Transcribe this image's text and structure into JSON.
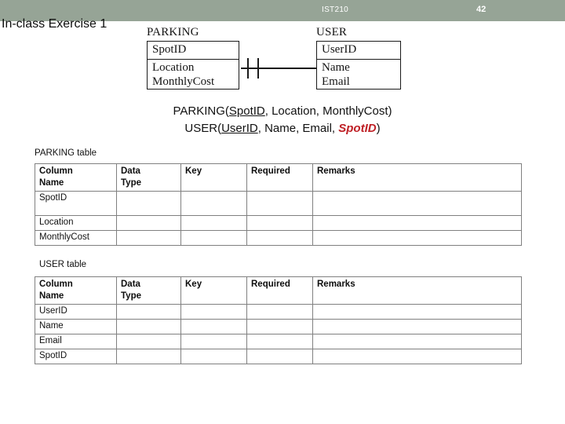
{
  "banner": {
    "course": "IST210",
    "page_number": "42",
    "background_color": "#96a496"
  },
  "slide": {
    "title": "In-class Exercise 1"
  },
  "er_diagram": {
    "entities": [
      {
        "name": "PARKING",
        "primary_key": "SpotID",
        "attributes": "Location\nMonthlyCost",
        "attribute_line_1": "Location",
        "attribute_line_2": "MonthlyCost"
      },
      {
        "name": "USER",
        "primary_key": "UserID",
        "attribute_line_1": "Name",
        "attribute_line_2": "Email"
      }
    ],
    "relationship": {
      "left_cardinality": "one-and-only-one",
      "right_cardinality": "zero-or-one"
    }
  },
  "schema": {
    "parking": {
      "entity": "PARKING(",
      "pk": "SpotID",
      "rest": ", Location, MonthlyCost)"
    },
    "user": {
      "entity": "USER(",
      "pk": "UserID",
      "mid": ", Name, Email, ",
      "fk": "SpotID",
      "close": ")"
    },
    "fk_color": "#bf2026"
  },
  "tables": [
    {
      "label": "PARKING table",
      "headers": [
        "Column Name",
        "Data Type",
        "Key",
        "Required",
        "Remarks"
      ],
      "header_lines": [
        [
          "Column",
          "Name"
        ],
        [
          "Data",
          "Type"
        ],
        [
          "Key",
          ""
        ],
        [
          "Required",
          ""
        ],
        [
          "Remarks",
          ""
        ]
      ],
      "rows": [
        {
          "name": "SpotID",
          "data_type": "",
          "key": "",
          "required": "",
          "remarks": ""
        },
        {
          "name": "Location",
          "data_type": "",
          "key": "",
          "required": "",
          "remarks": ""
        },
        {
          "name": "MonthlyCost",
          "data_type": "",
          "key": "",
          "required": "",
          "remarks": ""
        }
      ]
    },
    {
      "label": "USER table",
      "headers": [
        "Column Name",
        "Data Type",
        "Key",
        "Required",
        "Remarks"
      ],
      "header_lines": [
        [
          "Column",
          "Name"
        ],
        [
          "Data",
          "Type"
        ],
        [
          "Key",
          ""
        ],
        [
          "Required",
          ""
        ],
        [
          "Remarks",
          ""
        ]
      ],
      "rows": [
        {
          "name": "UserID",
          "data_type": "",
          "key": "",
          "required": "",
          "remarks": ""
        },
        {
          "name": "Name",
          "data_type": "",
          "key": "",
          "required": "",
          "remarks": ""
        },
        {
          "name": "Email",
          "data_type": "",
          "key": "",
          "required": "",
          "remarks": ""
        },
        {
          "name": "SpotID",
          "data_type": "",
          "key": "",
          "required": "",
          "remarks": ""
        }
      ]
    }
  ]
}
